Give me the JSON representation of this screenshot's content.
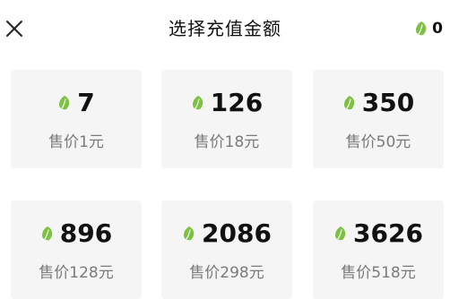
{
  "header": {
    "title": "选择充值金额",
    "balance": "0"
  },
  "colors": {
    "leaf": "#7cc142",
    "card_bg": "#f5f5f5",
    "price_text": "#7a7a7a"
  },
  "options": [
    {
      "amount": "7",
      "price": "售价1元"
    },
    {
      "amount": "126",
      "price": "售价18元"
    },
    {
      "amount": "350",
      "price": "售价50元"
    },
    {
      "amount": "896",
      "price": "售价128元"
    },
    {
      "amount": "2086",
      "price": "售价298元"
    },
    {
      "amount": "3626",
      "price": "售价518元"
    }
  ]
}
